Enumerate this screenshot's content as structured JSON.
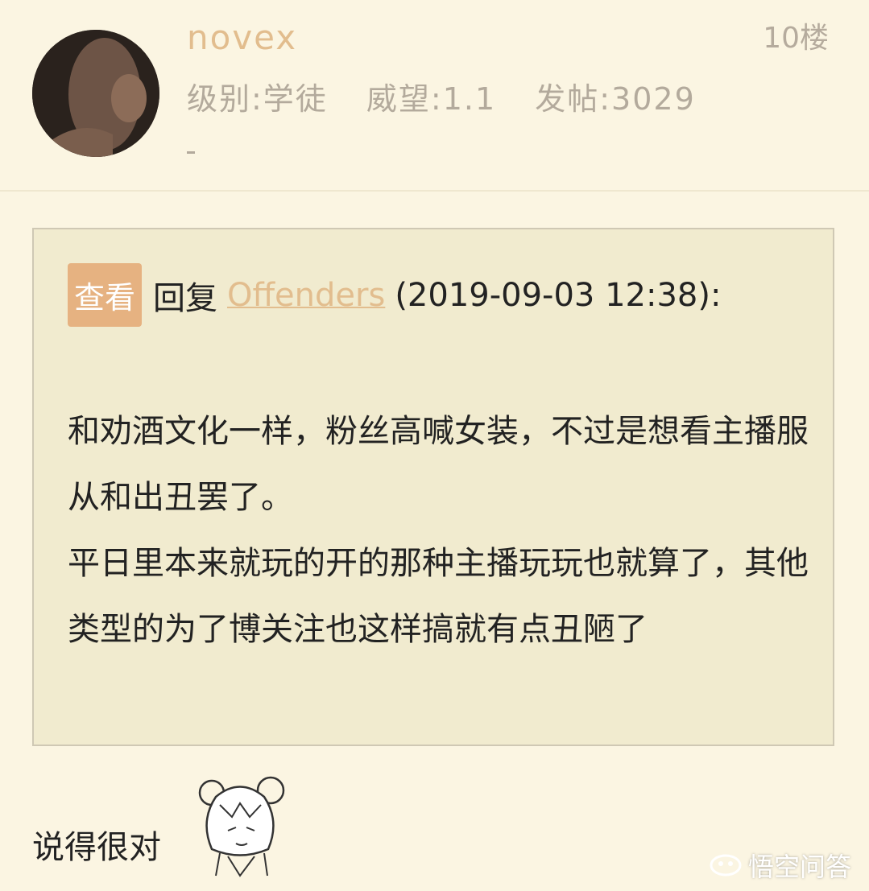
{
  "post": {
    "username": "novex",
    "floor": "10楼",
    "level": "级别:学徒",
    "prestige": "威望:1.1",
    "posts": "发帖:3029"
  },
  "quote": {
    "view_button": "查看",
    "reply_label": "回复",
    "reply_user": "Offenders",
    "reply_time": "(2019-09-03 12:38):",
    "paragraphs": [
      "和劝酒文化一样，粉丝高喊女装，不过是想看主播服从和出丑罢了。",
      "平日里本来就玩的开的那种主播玩玩也就算了，其他类型的为了博关注也这样搞就有点丑陋了"
    ]
  },
  "reply": {
    "text": "说得很对"
  },
  "watermark": {
    "text": "悟空问答"
  },
  "colors": {
    "background": "#fbf5e2",
    "quote_background": "#f1ebcf",
    "accent": "#e2bd8e",
    "button": "#e6b281"
  }
}
